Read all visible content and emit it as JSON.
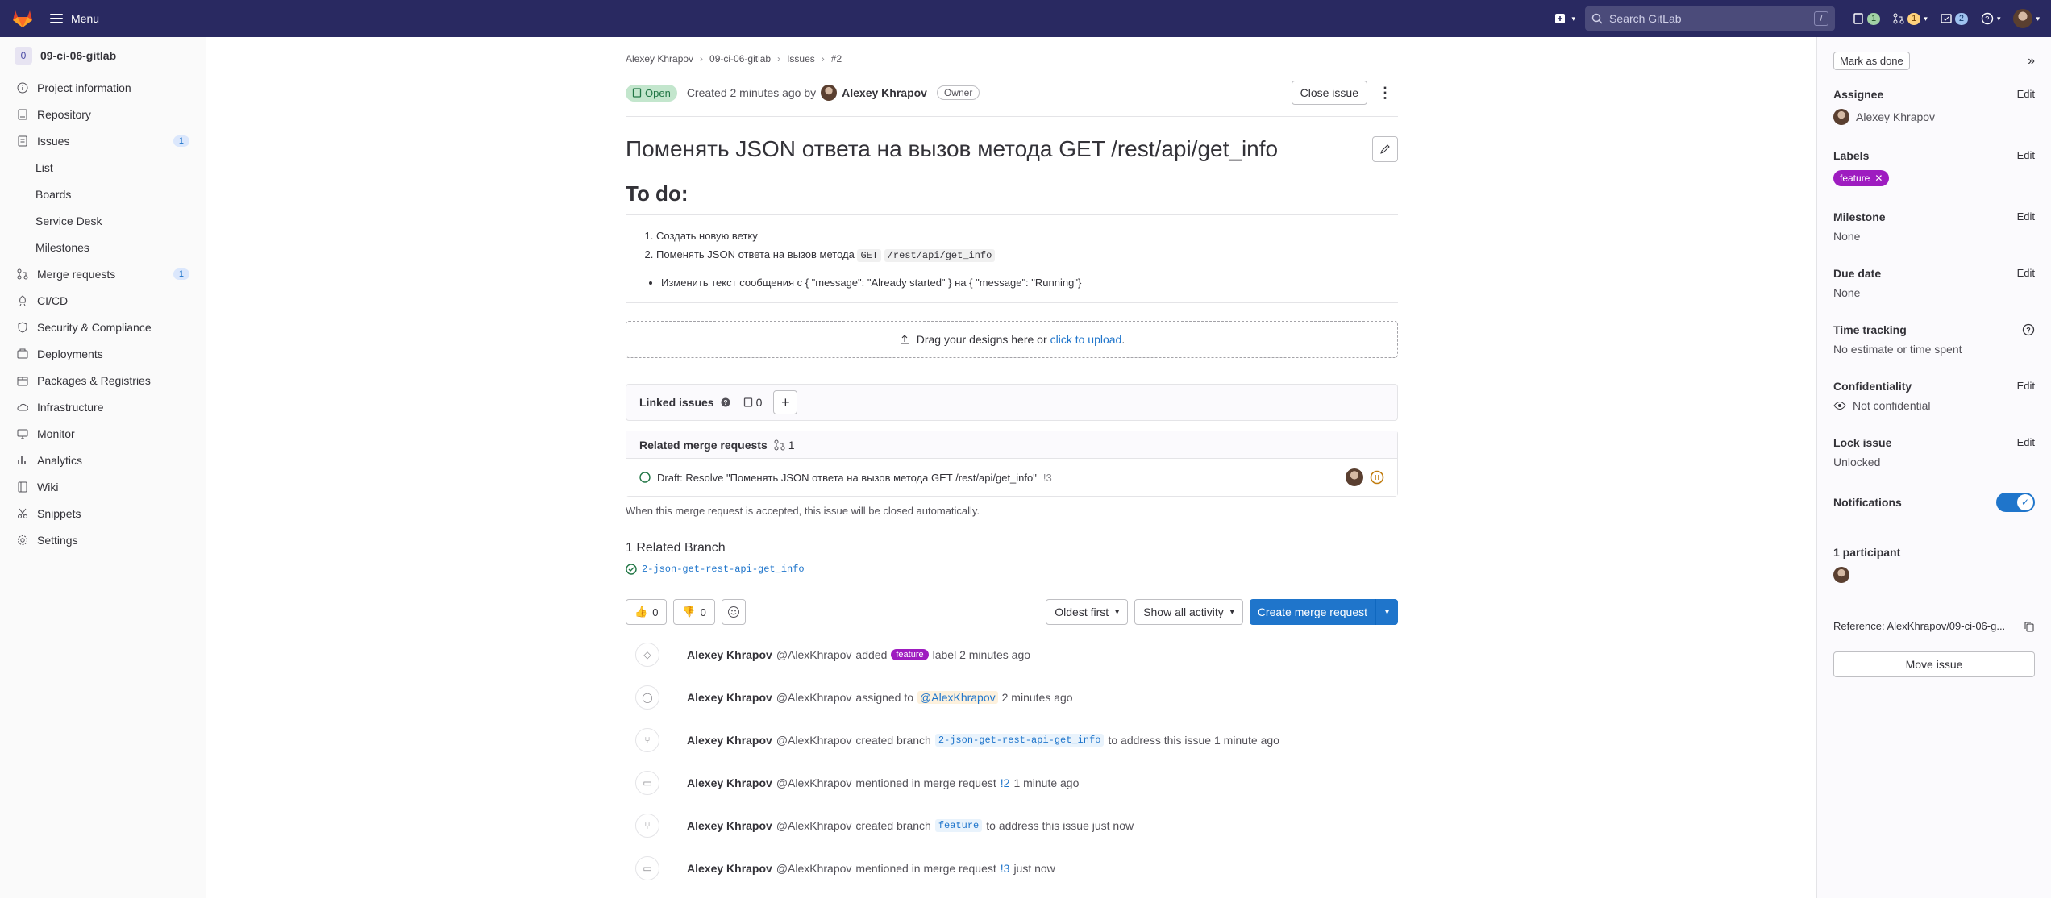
{
  "topbar": {
    "menu_label": "Menu",
    "search_placeholder": "Search GitLab",
    "search_shortcut": "/",
    "issues_count": "1",
    "mr_count": "1",
    "todos_count": "2"
  },
  "sidebar": {
    "project_initial": "0",
    "project_name": "09-ci-06-gitlab",
    "items": [
      {
        "label": "Project information",
        "icon": "info-icon"
      },
      {
        "label": "Repository",
        "icon": "repository-icon"
      },
      {
        "label": "Issues",
        "icon": "issues-icon",
        "badge": "1"
      },
      {
        "label": "Merge requests",
        "icon": "merge-request-icon",
        "badge": "1"
      },
      {
        "label": "CI/CD",
        "icon": "rocket-icon"
      },
      {
        "label": "Security & Compliance",
        "icon": "shield-icon"
      },
      {
        "label": "Deployments",
        "icon": "deployments-icon"
      },
      {
        "label": "Packages & Registries",
        "icon": "package-icon"
      },
      {
        "label": "Infrastructure",
        "icon": "cloud-icon"
      },
      {
        "label": "Monitor",
        "icon": "monitor-icon"
      },
      {
        "label": "Analytics",
        "icon": "chart-icon"
      },
      {
        "label": "Wiki",
        "icon": "book-icon"
      },
      {
        "label": "Snippets",
        "icon": "snippet-icon"
      },
      {
        "label": "Settings",
        "icon": "gear-icon"
      }
    ],
    "issue_sub": [
      "List",
      "Boards",
      "Service Desk",
      "Milestones"
    ]
  },
  "breadcrumb": [
    "Alexey Khrapov",
    "09-ci-06-gitlab",
    "Issues",
    "#2"
  ],
  "issue": {
    "status": "Open",
    "created_prefix": "Created 2 minutes ago by",
    "author": "Alexey Khrapov",
    "role": "Owner",
    "close_label": "Close issue",
    "title": "Поменять JSON ответа на вызов метода GET /rest/api/get_info",
    "todo_heading": "To do:",
    "ol_item1": "Создать новую ветку",
    "ol_item2_prefix": "Поменять JSON ответа на вызов метода",
    "ol_item2_code1": "GET",
    "ol_item2_code2": "/rest/api/get_info",
    "ul_item": "Изменить текст сообщения с { \"message\": \"Already started\" } на { \"message\": \"Running\"}"
  },
  "dropzone": {
    "text": "Drag your designs here or",
    "link": "click to upload",
    "dot": "."
  },
  "linked": {
    "label": "Linked issues",
    "count": "0"
  },
  "related_mr": {
    "label": "Related merge requests",
    "count": "1",
    "item": "Draft: Resolve \"Поменять JSON ответа на вызов метода GET /rest/api/get_info\"",
    "ref": "!3",
    "note": "When this merge request is accepted, this issue will be closed automatically."
  },
  "branch": {
    "heading": "1 Related Branch",
    "name": "2-json-get-rest-api-get_info"
  },
  "actions": {
    "thumbsup": "0",
    "thumbsdown": "0",
    "sort": "Oldest first",
    "filter": "Show all activity",
    "create_mr": "Create merge request"
  },
  "timeline": [
    {
      "icon": "label-icon",
      "author": "Alexey Khrapov",
      "handle": "@AlexKhrapov",
      "a": "added",
      "label": "feature",
      "b": "label 2 minutes ago"
    },
    {
      "icon": "user-icon",
      "author": "Alexey Khrapov",
      "handle": "@AlexKhrapov",
      "a": "assigned to",
      "mention": "@AlexKhrapov",
      "b": "2 minutes ago"
    },
    {
      "icon": "branch-icon",
      "author": "Alexey Khrapov",
      "handle": "@AlexKhrapov",
      "a": "created branch",
      "code": "2-json-get-rest-api-get_info",
      "b": "to address this issue 1 minute ago"
    },
    {
      "icon": "comment-icon",
      "author": "Alexey Khrapov",
      "handle": "@AlexKhrapov",
      "a": "mentioned in merge request",
      "ref": "!2",
      "b": "1 minute ago"
    },
    {
      "icon": "branch-icon",
      "author": "Alexey Khrapov",
      "handle": "@AlexKhrapov",
      "a": "created branch",
      "code": "feature",
      "b": "to address this issue just now"
    },
    {
      "icon": "comment-icon",
      "author": "Alexey Khrapov",
      "handle": "@AlexKhrapov",
      "a": "mentioned in merge request",
      "ref": "!3",
      "b": "just now"
    }
  ],
  "right": {
    "mark_done": "Mark as done",
    "assignee_h": "Assignee",
    "assignee": "Alexey Khrapov",
    "labels_h": "Labels",
    "label": "feature",
    "milestone_h": "Milestone",
    "milestone": "None",
    "due_h": "Due date",
    "due": "None",
    "time_h": "Time tracking",
    "time": "No estimate or time spent",
    "conf_h": "Confidentiality",
    "conf": "Not confidential",
    "lock_h": "Lock issue",
    "lock": "Unlocked",
    "notif_h": "Notifications",
    "participants_h": "1 participant",
    "reference": "Reference: AlexKhrapov/09-ci-06-g...",
    "move": "Move issue",
    "edit": "Edit"
  }
}
